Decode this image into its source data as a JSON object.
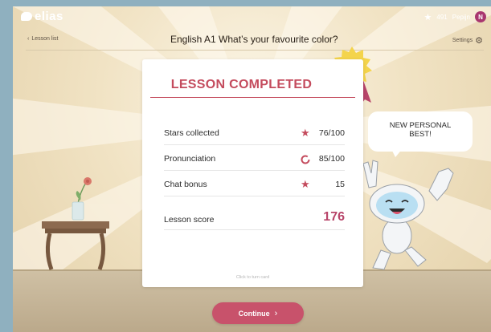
{
  "app": {
    "logo_text": "elias"
  },
  "topbar": {
    "stars_text": "491",
    "user_name": "Pepijn",
    "avatar_initial": "N"
  },
  "nav": {
    "back_label": "Lesson list",
    "lesson_title": "English A1   What’s your favourite color?",
    "settings_label": "Settings"
  },
  "card": {
    "title": "LESSON COMPLETED",
    "rows": [
      {
        "label": "Stars collected",
        "icon": "star-icon",
        "value": "76/100"
      },
      {
        "label": "Pronunciation",
        "icon": "progress-ring-icon",
        "value": "85/100"
      },
      {
        "label": "Chat bonus",
        "icon": "star-icon",
        "value": "15"
      }
    ],
    "score_label": "Lesson score",
    "score_value": "176",
    "turn_hint": "Click to turn card"
  },
  "bubble": {
    "line1": "NEW PERSONAL",
    "line2": "BEST!"
  },
  "continue_label": "Continue",
  "colors": {
    "accent": "#c44b5d",
    "button": "#c8526b",
    "background": "#f1e3c4",
    "frame": "#8fb0bf"
  }
}
